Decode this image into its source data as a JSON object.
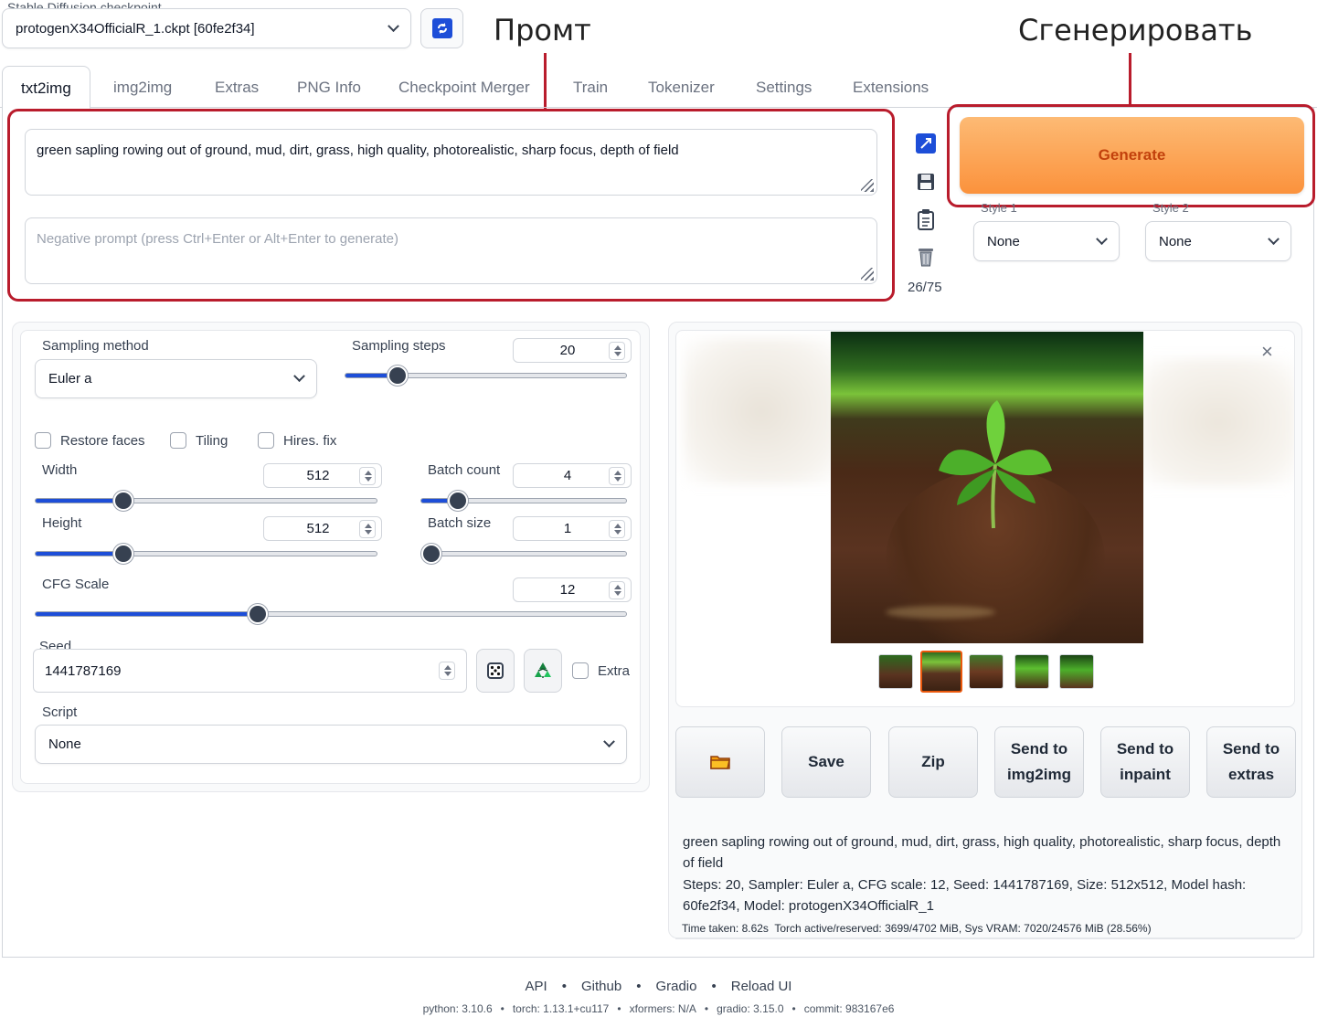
{
  "checkpoint": {
    "label": "Stable Diffusion checkpoint",
    "value": "protogenX34OfficialR_1.ckpt [60fe2f34]"
  },
  "annotations": {
    "prompt": "Промт",
    "generate": "Сгенерировать"
  },
  "tabs": [
    {
      "label": "txt2img"
    },
    {
      "label": "img2img"
    },
    {
      "label": "Extras"
    },
    {
      "label": "PNG Info"
    },
    {
      "label": "Checkpoint Merger"
    },
    {
      "label": "Train"
    },
    {
      "label": "Tokenizer"
    },
    {
      "label": "Settings"
    },
    {
      "label": "Extensions"
    }
  ],
  "prompt": {
    "value": "green sapling rowing out of ground, mud, dirt, grass, high quality, photorealistic, sharp focus, depth of field",
    "negative_placeholder": "Negative prompt (press Ctrl+Enter or Alt+Enter to generate)",
    "token_count": "26/75"
  },
  "generate_label": "Generate",
  "styles": {
    "style1_label": "Style 1",
    "style1_value": "None",
    "style2_label": "Style 2",
    "style2_value": "None"
  },
  "params": {
    "sampling_method_label": "Sampling method",
    "sampling_method_value": "Euler a",
    "sampling_steps_label": "Sampling steps",
    "sampling_steps_value": "20",
    "restore_faces": "Restore faces",
    "tiling": "Tiling",
    "hires_fix": "Hires. fix",
    "width_label": "Width",
    "width_value": "512",
    "height_label": "Height",
    "height_value": "512",
    "batch_count_label": "Batch count",
    "batch_count_value": "4",
    "batch_size_label": "Batch size",
    "batch_size_value": "1",
    "cfg_label": "CFG Scale",
    "cfg_value": "12",
    "seed_label": "Seed",
    "seed_value": "1441787169",
    "extra_label": "Extra",
    "script_label": "Script",
    "script_value": "None"
  },
  "sliders": {
    "steps": 0.16,
    "width": 0.24,
    "height": 0.24,
    "batch_count": 0.14,
    "batch_size": 0.0,
    "cfg": 0.37
  },
  "output": {
    "close": "×",
    "buttons": {
      "save": "Save",
      "zip": "Zip",
      "send_img2img": "Send to img2img",
      "send_inpaint": "Send to inpaint",
      "send_extras": "Send to extras"
    },
    "info_prompt": "green sapling rowing out of ground, mud, dirt, grass, high quality, photorealistic, sharp focus, depth of field",
    "info_params": "Steps: 20, Sampler: Euler a, CFG scale: 12, Seed: 1441787169, Size: 512x512, Model hash: 60fe2f34, Model: protogenX34OfficialR_1",
    "time": "Time taken: 8.62s  Torch active/reserved: 3699/4702 MiB, Sys VRAM: 7020/24576 MiB (28.56%)"
  },
  "footer": {
    "links": [
      "API",
      "Github",
      "Gradio",
      "Reload UI"
    ],
    "sep": "•",
    "versions": [
      "python: 3.10.6",
      "torch: 1.13.1+cu117",
      "xformers: N/A",
      "gradio: 3.15.0",
      "commit: 983167e6"
    ]
  },
  "colors": {
    "accent_blue": "#1d4ed8",
    "generate_orange": "#fb923c",
    "annotation_red": "#b91c2c"
  }
}
